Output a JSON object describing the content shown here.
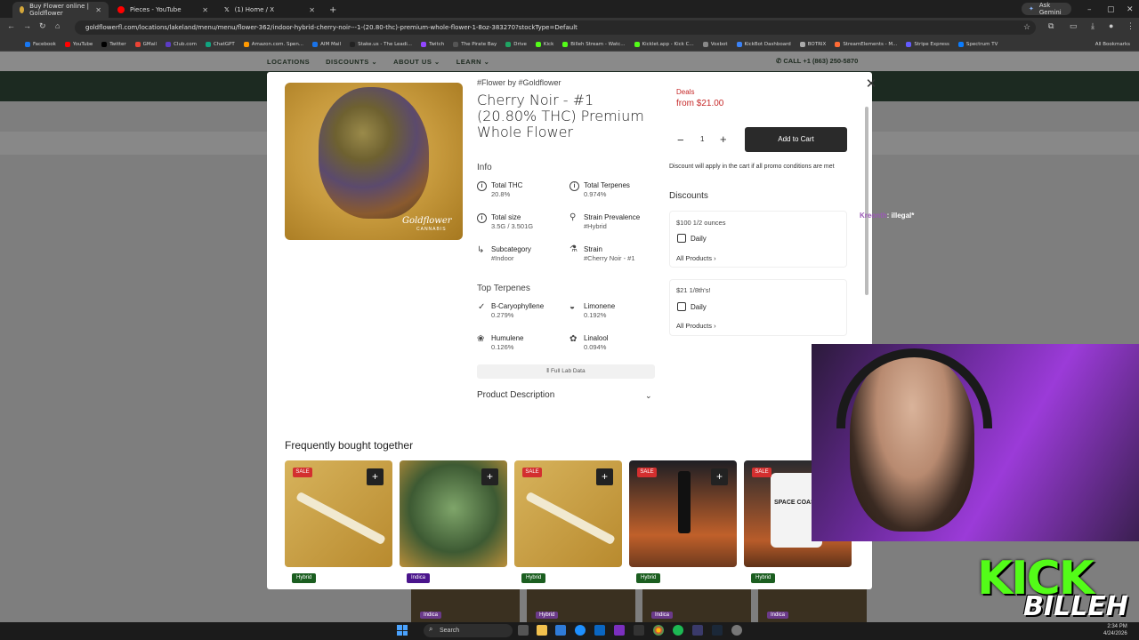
{
  "browser": {
    "tabs": [
      {
        "title": "Buy Flower online | Goldflower",
        "color": "#d4a73a"
      },
      {
        "title": "Pieces - YouTube",
        "color": "#ff0000"
      },
      {
        "title": "(1) Home / X",
        "color": "#000000"
      }
    ],
    "ask_gemini": "Ask Gemini",
    "url": "goldflowerfl.com/locations/lakeland/menu/menu/flower-362/indoor-hybrid-cherry-noir---1-(20.80-thc)-premium-whole-flower-1-8oz-383270?stockType=Default",
    "bookmarks": [
      "Facebook",
      "YouTube",
      "Twitter",
      "GMail",
      "Club.com",
      "ChatGPT",
      "Amazon.com. Spen...",
      "AIM Mail",
      "Stake.us - The Leadi...",
      "Twitch",
      "The Pirate Bay",
      "Drive",
      "Kick",
      "Billeh Stream - Watc...",
      "Kicklet.app - Kick C...",
      "Voxbot",
      "KickBot Dashboard",
      "BOTRIX",
      "StreamElements - M...",
      "Stripe Express",
      "Spectrum TV"
    ],
    "all_bookmarks": "All Bookmarks"
  },
  "site": {
    "nav": [
      "LOCATIONS",
      "DISCOUNTS ⌄",
      "ABOUT US ⌄",
      "LEARN ⌄"
    ],
    "phone": "CALL +1 (863) 250-5870",
    "bg_tags": [
      "Indica",
      "Hybrid",
      "Indica",
      "Indica"
    ]
  },
  "product": {
    "brand_line": "#Flower by #Goldflower",
    "title": "Cherry Noir - #1 (20.80% THC) Premium Whole Flower",
    "image_logo": "Goldflower",
    "image_logo_sub": "CANNABIS",
    "info_heading": "Info",
    "info": {
      "thc_label": "Total THC",
      "thc_value": "20.8%",
      "terp_label": "Total Terpenes",
      "terp_value": "0.974%",
      "size_label": "Total size",
      "size_value": "3.5G / 3.501G",
      "strain_prev_label": "Strain Prevalence",
      "strain_prev_value": "#Hybrid",
      "subcat_label": "Subcategory",
      "subcat_value": "#Indoor",
      "strain_label": "Strain",
      "strain_value": "#Cherry Noir - #1"
    },
    "terpenes_heading": "Top Terpenes",
    "terpenes": {
      "t1_name": "B-Caryophyllene",
      "t1_value": "0.279%",
      "t2_name": "Limonene",
      "t2_value": "0.192%",
      "t3_name": "Humulene",
      "t3_value": "0.126%",
      "t4_name": "Linalool",
      "t4_value": "0.094%"
    },
    "full_lab": "Full Lab Data",
    "description_label": "Product Description"
  },
  "purchase": {
    "deals_label": "Deals",
    "price": "from $21.00",
    "quantity": "1",
    "add_to_cart": "Add to Cart",
    "promo_note": "Discount will apply in the cart if all promo conditions are met"
  },
  "discounts": {
    "heading": "Discounts",
    "d1_name": "$100 1/2 ounces",
    "d1_schedule": "Daily",
    "d1_link": "All Products",
    "d2_name": "$21 1/8th's!",
    "d2_schedule": "Daily",
    "d2_link": "All Products"
  },
  "fbt": {
    "heading": "Frequently bought together",
    "sale": "SALE",
    "tags": [
      "Hybrid",
      "Indica",
      "Hybrid",
      "Hybrid",
      "Hybrid"
    ],
    "tag_colors": [
      "#1b5e20",
      "#4a148c",
      "#1b5e20",
      "#1b5e20",
      "#1b5e20"
    ],
    "card5_text": "SPACE COAST"
  },
  "overlay": {
    "chat_user": "Kreonth",
    "chat_msg": ": illegal*",
    "logo_top": "KICK",
    "logo_bottom": "BILLEH"
  },
  "taskbar": {
    "search": "Search",
    "time": "2:34 PM",
    "date": "4/24/2026"
  }
}
